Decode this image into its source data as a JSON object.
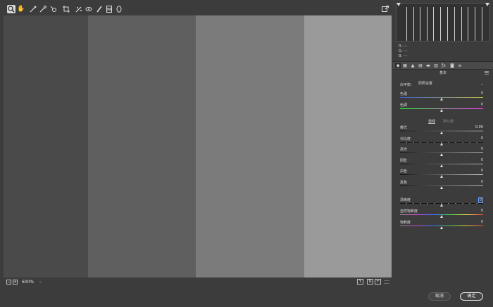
{
  "toolbar": {
    "tools": [
      "zoom-tool",
      "hand-tool",
      "white-balance-tool",
      "color-sampler-tool",
      "target-adjustment-tool",
      "crop-tool",
      "spot-removal-tool",
      "red-eye-tool",
      "adjustment-brush-tool",
      "graduated-filter-tool",
      "radial-filter-tool"
    ],
    "active_tool": "zoom-tool"
  },
  "histogram": {
    "r_label": "R:",
    "g_label": "G:",
    "b_label": "B:",
    "r_value": "---",
    "g_value": "---",
    "b_value": "---"
  },
  "panel": {
    "section_title": "基本",
    "white_balance_label": "白平衡:",
    "white_balance_value": "原照设置",
    "auto_label": "自动",
    "default_label": "默认值"
  },
  "controls": [
    {
      "label": "色温",
      "value": "0",
      "pos": 0.5
    },
    {
      "label": "色调",
      "value": "0",
      "pos": 0.5
    },
    {
      "label": "曝光",
      "value": "0.00",
      "pos": 0.5
    },
    {
      "label": "对比度",
      "value": "0",
      "pos": 0.5
    },
    {
      "label": "高光",
      "value": "0",
      "pos": 0.5
    },
    {
      "label": "阴影",
      "value": "0",
      "pos": 0.5
    },
    {
      "label": "白色",
      "value": "0",
      "pos": 0.5
    },
    {
      "label": "黑色",
      "value": "0",
      "pos": 0.5
    },
    {
      "label": "清晰度",
      "value": "0",
      "pos": 0.5
    },
    {
      "label": "自然饱和度",
      "value": "0",
      "pos": 0.5
    },
    {
      "label": "饱和度",
      "value": "0",
      "pos": 0.5
    }
  ],
  "bottombar": {
    "zoom_level": "600%",
    "view_y_label": "Y"
  },
  "buttons": {
    "cancel": "取消",
    "ok": "确定"
  }
}
